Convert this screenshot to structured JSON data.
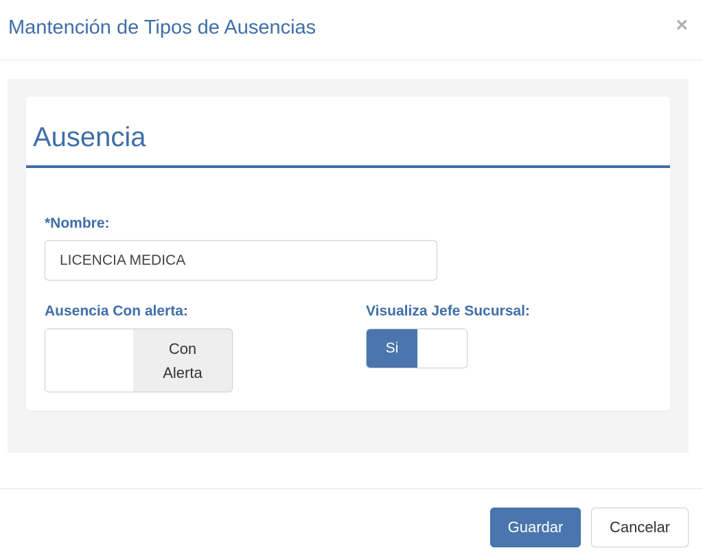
{
  "modal": {
    "title": "Mantención de Tipos de Ausencias",
    "close_glyph": "×"
  },
  "panel": {
    "title": "Ausencia"
  },
  "form": {
    "nombre_label": "*Nombre:",
    "nombre_value": "LICENCIA MEDICA",
    "alerta_label": "Ausencia Con alerta:",
    "alerta_state_line1": "Con",
    "alerta_state_line2": "Alerta",
    "jefe_label": "Visualiza Jefe Sucursal:",
    "jefe_state": "Si"
  },
  "footer": {
    "save_label": "Guardar",
    "cancel_label": "Cancelar"
  },
  "colors": {
    "accent": "#3f6ea8",
    "primary_button": "#4a76ad",
    "body_background": "#f4f4f4"
  },
  "icons": {
    "close": "close-icon"
  }
}
